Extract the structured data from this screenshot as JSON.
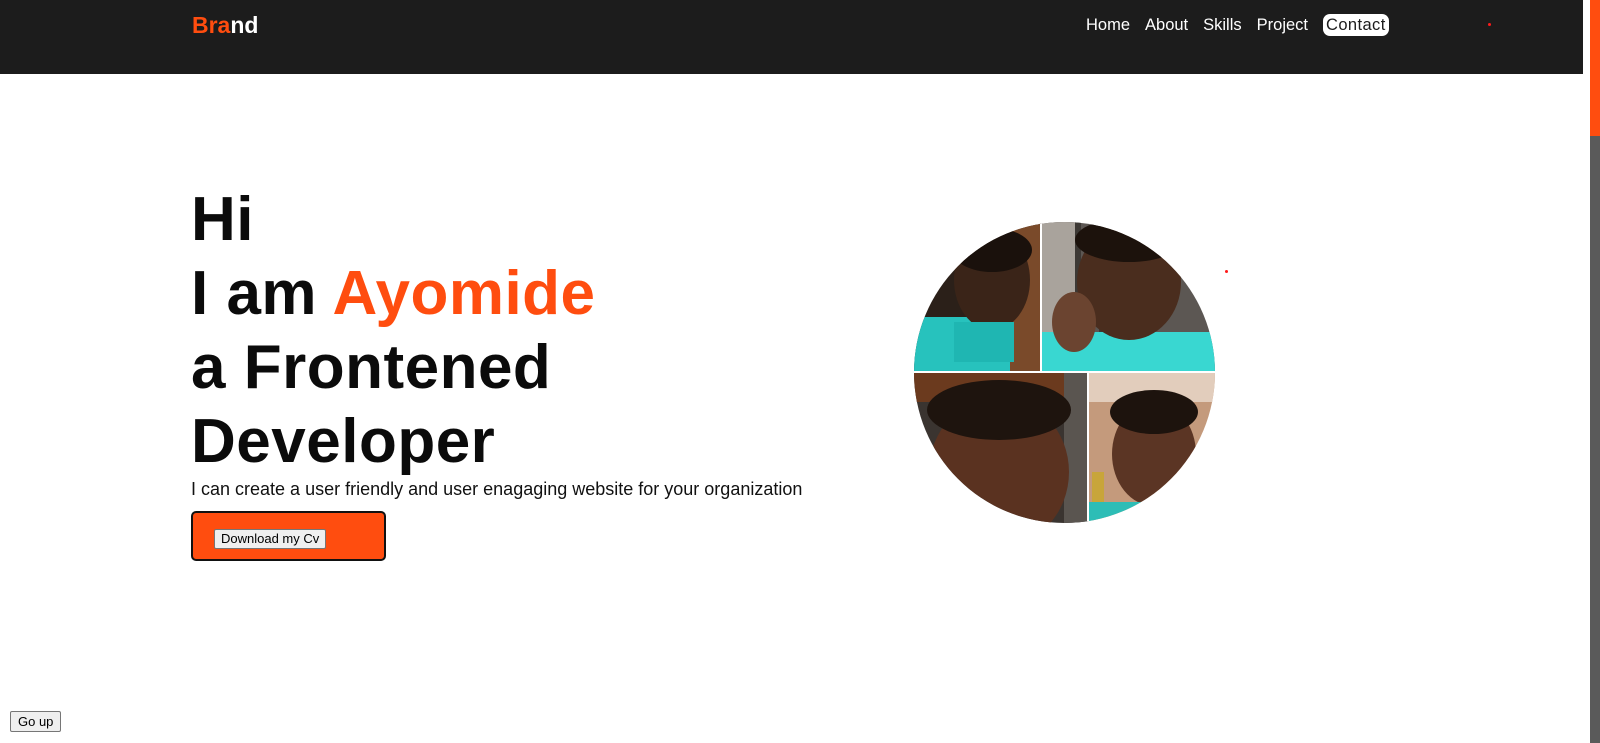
{
  "header": {
    "brand_accent": "Bra",
    "brand_rest": "nd",
    "nav": {
      "home": "Home",
      "about": "About",
      "skills": "Skills",
      "project": "Project",
      "contact": "Contact"
    }
  },
  "hero": {
    "greeting": "Hi",
    "intro": "I am ",
    "name": "Ayomide",
    "role_line1": "a Frontened",
    "role_line2": "Developer",
    "tagline": "I can create a user friendly and user enagaging website for your organization",
    "cv_button": "Download my Cv"
  },
  "footer": {
    "go_up": "Go up"
  },
  "colors": {
    "accent": "#ff4d0f",
    "header_bg": "#1c1c1c",
    "text": "#0b0b0b"
  },
  "icons": [
    "red-dot-decoration"
  ]
}
